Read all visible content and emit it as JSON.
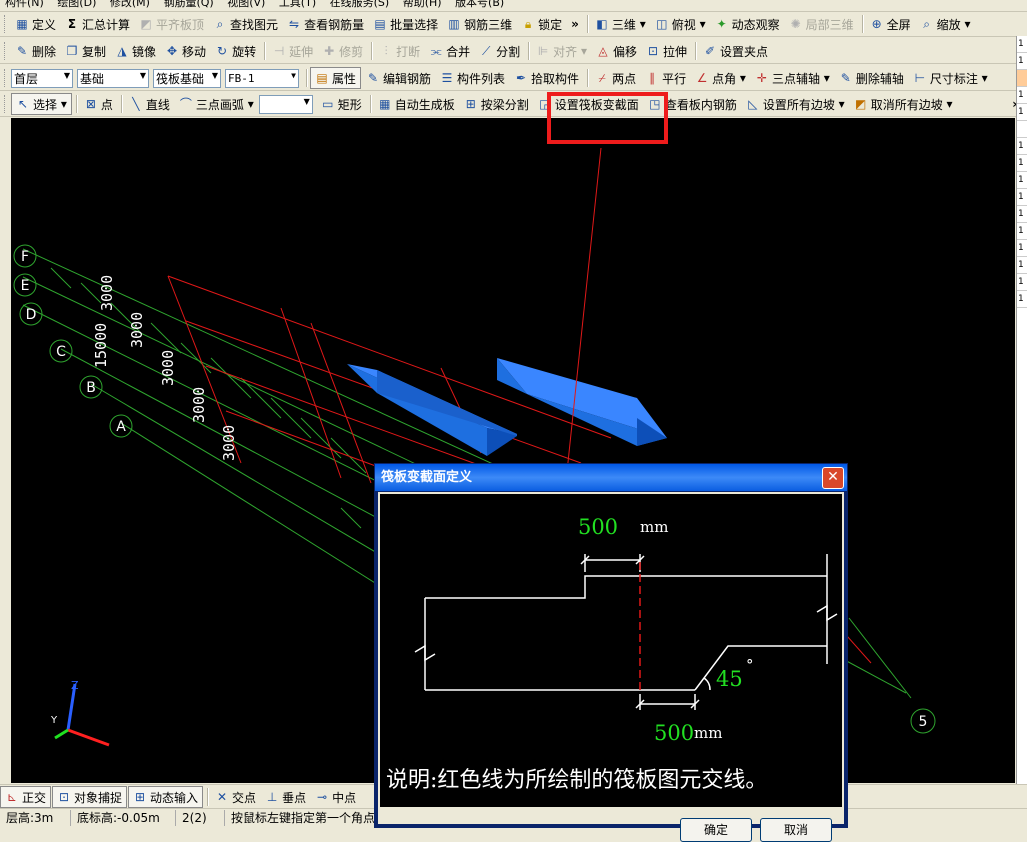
{
  "menu": [
    "构件(N)",
    "绘图(D)",
    "修改(M)",
    "钢筋量(Q)",
    "视图(V)",
    "工具(T)",
    "在线服务(S)",
    "帮助(H)",
    "版本号(B)"
  ],
  "toolbar1": {
    "define": "定义",
    "summary": "汇总计算",
    "flat_top": "平齐板顶",
    "find": "查找图元",
    "view_rebar": "查看钢筋量",
    "batch_select": "批量选择",
    "rebar_3d": "钢筋三维",
    "lock": "锁定",
    "view_3d": "三维",
    "top_view": "俯视",
    "dynamic_view": "动态观察",
    "local_3d": "局部三维",
    "fullscreen": "全屏",
    "zoom": "缩放"
  },
  "toolbar2": {
    "delete": "删除",
    "copy": "复制",
    "mirror": "镜像",
    "move": "移动",
    "rotate": "旋转",
    "extend": "延伸",
    "trim": "修剪",
    "break": "打断",
    "merge": "合并",
    "split": "分割",
    "align": "对齐",
    "offset": "偏移",
    "stretch": "拉伸",
    "set_grip": "设置夹点"
  },
  "toolbar3": {
    "floor": "首层",
    "category": "基础",
    "type": "筏板基础",
    "element": "FB-1",
    "properties": "属性",
    "edit_rebar": "编辑钢筋",
    "component_list": "构件列表",
    "pick": "拾取构件",
    "two_points": "两点",
    "parallel": "平行",
    "point_angle": "点角",
    "three_point_aux": "三点辅轴",
    "delete_aux": "删除辅轴",
    "dimension": "尺寸标注"
  },
  "toolbar4": {
    "select": "选择",
    "point": "点",
    "line": "直线",
    "arc": "三点画弧",
    "rect": "矩形",
    "auto_slab": "自动生成板",
    "split_by_beam": "按梁分割",
    "set_section": "设置筏板变截面",
    "view_slab_rebar": "查看板内钢筋",
    "set_all_slopes": "设置所有边坡",
    "cancel_all_slopes": "取消所有边坡"
  },
  "grid": {
    "axes": [
      "F",
      "E",
      "D",
      "C",
      "B",
      "A"
    ],
    "spacings": [
      "3000",
      "3000",
      "15000",
      "3000",
      "3000",
      "3000"
    ],
    "end_axis": "5"
  },
  "dialog": {
    "title": "筏板变截面定义",
    "top_dim_value": "500",
    "top_dim_unit": "mm",
    "bottom_dim_value": "500",
    "bottom_dim_unit": "mm",
    "angle_value": "45",
    "angle_unit": "°",
    "note": "说明:红色线为所绘制的筏板图元交线。",
    "ok": "确定",
    "cancel": "取消"
  },
  "snap": {
    "ortho": "正交",
    "object_snap": "对象捕捉",
    "dynamic_input": "动态输入",
    "intersection": "交点",
    "perpendicular": "垂点",
    "midpoint": "中点"
  },
  "status": {
    "floor_height": "层高:3m",
    "bottom_elev": "底标高:-0.05m",
    "count": "2(2)",
    "hint": "按鼠标左键指定第一个角点，"
  },
  "right_panel": [
    "1",
    "1",
    "",
    "1",
    "1",
    "",
    "1",
    "1",
    "1",
    "1",
    "1",
    "1",
    "1",
    "1",
    "1",
    "1"
  ],
  "colors": {
    "canvas_bg": "#000000",
    "grid_green": "#2fa52f",
    "slab_red": "#e01818",
    "block_blue": "#1e6fe0",
    "dim_green": "#22e022",
    "highlight_red": "#ee1c1c"
  }
}
